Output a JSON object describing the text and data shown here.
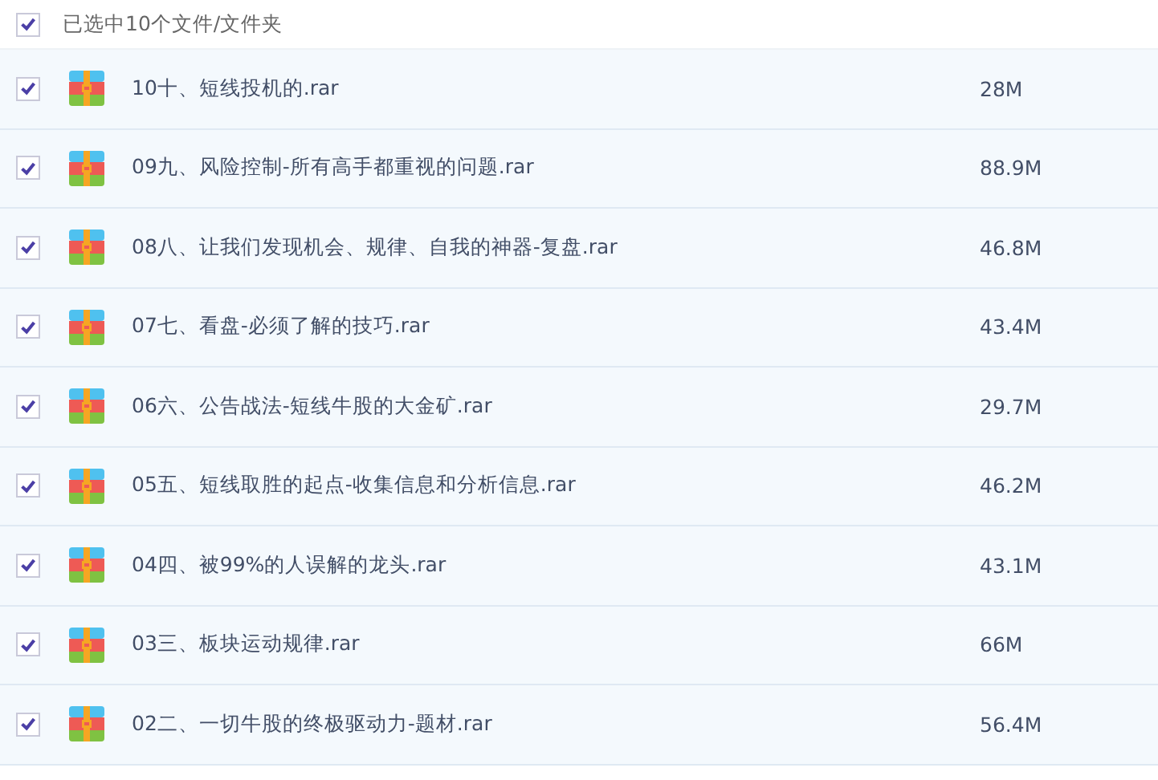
{
  "header": {
    "checked": true,
    "label": "已选中10个文件/文件夹"
  },
  "files": [
    {
      "checked": true,
      "name": "10十、短线投机的.rar",
      "size": "28M"
    },
    {
      "checked": true,
      "name": "09九、风险控制-所有高手都重视的问题.rar",
      "size": "88.9M"
    },
    {
      "checked": true,
      "name": "08八、让我们发现机会、规律、自我的神器-复盘.rar",
      "size": "46.8M"
    },
    {
      "checked": true,
      "name": "07七、看盘-必须了解的技巧.rar",
      "size": "43.4M"
    },
    {
      "checked": true,
      "name": "06六、公告战法-短线牛股的大金矿.rar",
      "size": "29.7M"
    },
    {
      "checked": true,
      "name": "05五、短线取胜的起点-收集信息和分析信息.rar",
      "size": "46.2M"
    },
    {
      "checked": true,
      "name": "04四、被99%的人误解的龙头.rar",
      "size": "43.1M"
    },
    {
      "checked": true,
      "name": "03三、板块运动规律.rar",
      "size": "66M"
    },
    {
      "checked": true,
      "name": "02二、一切牛股的终极驱动力-题材.rar",
      "size": "56.4M"
    }
  ]
}
